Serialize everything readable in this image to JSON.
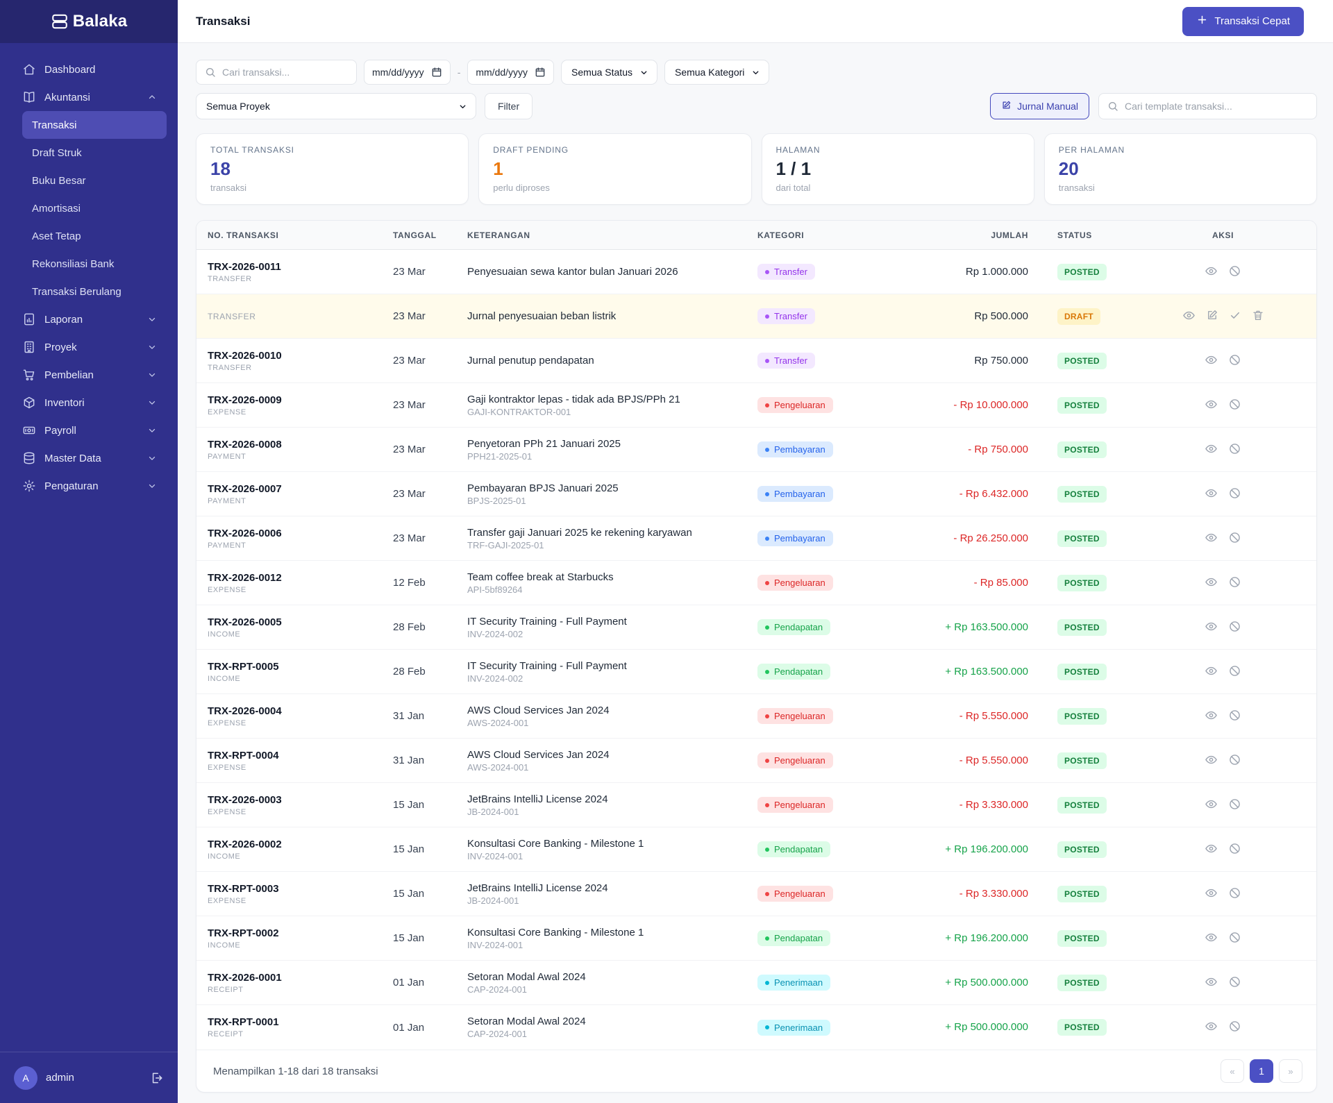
{
  "brand": {
    "name": "Balaka",
    "logo_icon": "ledger-icon"
  },
  "topbar": {
    "title": "Transaksi",
    "quick_action": "Transaksi Cepat",
    "quick_action_icon": "plus-icon"
  },
  "sidebar": {
    "items": [
      {
        "label": "Dashboard",
        "icon": "home-icon"
      },
      {
        "label": "Akuntansi",
        "icon": "book-icon",
        "chevron": "up"
      },
      {
        "label": "Transaksi",
        "child": true,
        "active": true
      },
      {
        "label": "Draft Struk",
        "child": true
      },
      {
        "label": "Buku Besar",
        "child": true
      },
      {
        "label": "Amortisasi",
        "child": true
      },
      {
        "label": "Aset Tetap",
        "child": true
      },
      {
        "label": "Rekonsiliasi Bank",
        "child": true
      },
      {
        "label": "Transaksi Berulang",
        "child": true
      },
      {
        "label": "Laporan",
        "icon": "report-icon",
        "chevron": "down"
      },
      {
        "label": "Proyek",
        "icon": "building-icon",
        "chevron": "down"
      },
      {
        "label": "Pembelian",
        "icon": "cart-icon",
        "chevron": "down"
      },
      {
        "label": "Inventori",
        "icon": "cube-icon",
        "chevron": "down"
      },
      {
        "label": "Payroll",
        "icon": "banknote-icon",
        "chevron": "down"
      },
      {
        "label": "Master Data",
        "icon": "database-icon",
        "chevron": "down"
      },
      {
        "label": "Pengaturan",
        "icon": "gear-icon",
        "chevron": "down"
      }
    ],
    "user": {
      "initial": "A",
      "name": "admin",
      "logout_icon": "logout-icon"
    }
  },
  "filters": {
    "search_placeholder": "Cari transaksi...",
    "date_from": "mm/dd/yyyy",
    "date_to": "mm/dd/yyyy",
    "date_separator": "-",
    "status_select": "Semua Status",
    "category_select": "Semua Kategori",
    "project_select": "Semua Proyek",
    "filter_button": "Filter",
    "journal_button": "Jurnal Manual",
    "template_search_placeholder": "Cari template transaksi..."
  },
  "cards": [
    {
      "label": "TOTAL TRANSAKSI",
      "value": "18",
      "sub": "transaksi",
      "tone": "indigo"
    },
    {
      "label": "DRAFT PENDING",
      "value": "1",
      "sub": "perlu diproses",
      "tone": "orange"
    },
    {
      "label": "HALAMAN",
      "value": "1 / 1",
      "sub": "dari total",
      "tone": "dark"
    },
    {
      "label": "PER HALAMAN",
      "value": "20",
      "sub": "transaksi",
      "tone": "indigo"
    }
  ],
  "table": {
    "columns": [
      "NO. TRANSAKSI",
      "TANGGAL",
      "KETERANGAN",
      "KATEGORI",
      "JUMLAH",
      "STATUS",
      "AKSI"
    ],
    "rows": [
      {
        "number": "TRX-2026-0011",
        "type": "TRANSFER",
        "date": "23 Mar",
        "description": "Penyesuaian sewa kantor bulan Januari 2026",
        "reference": "",
        "category": "Transfer",
        "category_color": "purple",
        "amount": "Rp 1.000.000",
        "amount_tone": "neutral",
        "status": "POSTED",
        "actions": [
          "view",
          "void"
        ],
        "draft": false
      },
      {
        "number": "",
        "type": "TRANSFER",
        "date": "23 Mar",
        "description": "Jurnal penyesuaian beban listrik",
        "reference": "",
        "category": "Transfer",
        "category_color": "purple",
        "amount": "Rp 500.000",
        "amount_tone": "neutral",
        "status": "DRAFT",
        "actions": [
          "view",
          "edit",
          "approve",
          "delete"
        ],
        "draft": true
      },
      {
        "number": "TRX-2026-0010",
        "type": "TRANSFER",
        "date": "23 Mar",
        "description": "Jurnal penutup pendapatan",
        "reference": "",
        "category": "Transfer",
        "category_color": "purple",
        "amount": "Rp 750.000",
        "amount_tone": "neutral",
        "status": "POSTED",
        "actions": [
          "view",
          "void"
        ],
        "draft": false
      },
      {
        "number": "TRX-2026-0009",
        "type": "EXPENSE",
        "date": "23 Mar",
        "description": "Gaji kontraktor lepas - tidak ada BPJS/PPh 21",
        "reference": "GAJI-KONTRAKTOR-001",
        "category": "Pengeluaran",
        "category_color": "red",
        "amount": "- Rp 10.000.000",
        "amount_tone": "neg",
        "status": "POSTED",
        "actions": [
          "view",
          "void"
        ],
        "draft": false
      },
      {
        "number": "TRX-2026-0008",
        "type": "PAYMENT",
        "date": "23 Mar",
        "description": "Penyetoran PPh 21 Januari 2025",
        "reference": "PPH21-2025-01",
        "category": "Pembayaran",
        "category_color": "blue",
        "amount": "- Rp 750.000",
        "amount_tone": "neg",
        "status": "POSTED",
        "actions": [
          "view",
          "void"
        ],
        "draft": false
      },
      {
        "number": "TRX-2026-0007",
        "type": "PAYMENT",
        "date": "23 Mar",
        "description": "Pembayaran BPJS Januari 2025",
        "reference": "BPJS-2025-01",
        "category": "Pembayaran",
        "category_color": "blue",
        "amount": "- Rp 6.432.000",
        "amount_tone": "neg",
        "status": "POSTED",
        "actions": [
          "view",
          "void"
        ],
        "draft": false
      },
      {
        "number": "TRX-2026-0006",
        "type": "PAYMENT",
        "date": "23 Mar",
        "description": "Transfer gaji Januari 2025 ke rekening karyawan",
        "reference": "TRF-GAJI-2025-01",
        "category": "Pembayaran",
        "category_color": "blue",
        "amount": "- Rp 26.250.000",
        "amount_tone": "neg",
        "status": "POSTED",
        "actions": [
          "view",
          "void"
        ],
        "draft": false
      },
      {
        "number": "TRX-2026-0012",
        "type": "EXPENSE",
        "date": "12 Feb",
        "description": "Team coffee break at Starbucks",
        "reference": "API-5bf89264",
        "category": "Pengeluaran",
        "category_color": "red",
        "amount": "- Rp 85.000",
        "amount_tone": "neg",
        "status": "POSTED",
        "actions": [
          "view",
          "void"
        ],
        "draft": false
      },
      {
        "number": "TRX-2026-0005",
        "type": "INCOME",
        "date": "28 Feb",
        "description": "IT Security Training - Full Payment",
        "reference": "INV-2024-002",
        "category": "Pendapatan",
        "category_color": "green",
        "amount": "+ Rp 163.500.000",
        "amount_tone": "pos",
        "status": "POSTED",
        "actions": [
          "view",
          "void"
        ],
        "draft": false
      },
      {
        "number": "TRX-RPT-0005",
        "type": "INCOME",
        "date": "28 Feb",
        "description": "IT Security Training - Full Payment",
        "reference": "INV-2024-002",
        "category": "Pendapatan",
        "category_color": "green",
        "amount": "+ Rp 163.500.000",
        "amount_tone": "pos",
        "status": "POSTED",
        "actions": [
          "view",
          "void"
        ],
        "draft": false
      },
      {
        "number": "TRX-2026-0004",
        "type": "EXPENSE",
        "date": "31 Jan",
        "description": "AWS Cloud Services Jan 2024",
        "reference": "AWS-2024-001",
        "category": "Pengeluaran",
        "category_color": "red",
        "amount": "- Rp 5.550.000",
        "amount_tone": "neg",
        "status": "POSTED",
        "actions": [
          "view",
          "void"
        ],
        "draft": false
      },
      {
        "number": "TRX-RPT-0004",
        "type": "EXPENSE",
        "date": "31 Jan",
        "description": "AWS Cloud Services Jan 2024",
        "reference": "AWS-2024-001",
        "category": "Pengeluaran",
        "category_color": "red",
        "amount": "- Rp 5.550.000",
        "amount_tone": "neg",
        "status": "POSTED",
        "actions": [
          "view",
          "void"
        ],
        "draft": false
      },
      {
        "number": "TRX-2026-0003",
        "type": "EXPENSE",
        "date": "15 Jan",
        "description": "JetBrains IntelliJ License 2024",
        "reference": "JB-2024-001",
        "category": "Pengeluaran",
        "category_color": "red",
        "amount": "- Rp 3.330.000",
        "amount_tone": "neg",
        "status": "POSTED",
        "actions": [
          "view",
          "void"
        ],
        "draft": false
      },
      {
        "number": "TRX-2026-0002",
        "type": "INCOME",
        "date": "15 Jan",
        "description": "Konsultasi Core Banking - Milestone 1",
        "reference": "INV-2024-001",
        "category": "Pendapatan",
        "category_color": "green",
        "amount": "+ Rp 196.200.000",
        "amount_tone": "pos",
        "status": "POSTED",
        "actions": [
          "view",
          "void"
        ],
        "draft": false
      },
      {
        "number": "TRX-RPT-0003",
        "type": "EXPENSE",
        "date": "15 Jan",
        "description": "JetBrains IntelliJ License 2024",
        "reference": "JB-2024-001",
        "category": "Pengeluaran",
        "category_color": "red",
        "amount": "- Rp 3.330.000",
        "amount_tone": "neg",
        "status": "POSTED",
        "actions": [
          "view",
          "void"
        ],
        "draft": false
      },
      {
        "number": "TRX-RPT-0002",
        "type": "INCOME",
        "date": "15 Jan",
        "description": "Konsultasi Core Banking - Milestone 1",
        "reference": "INV-2024-001",
        "category": "Pendapatan",
        "category_color": "green",
        "amount": "+ Rp 196.200.000",
        "amount_tone": "pos",
        "status": "POSTED",
        "actions": [
          "view",
          "void"
        ],
        "draft": false
      },
      {
        "number": "TRX-2026-0001",
        "type": "RECEIPT",
        "date": "01 Jan",
        "description": "Setoran Modal Awal 2024",
        "reference": "CAP-2024-001",
        "category": "Penerimaan",
        "category_color": "cyan",
        "amount": "+ Rp 500.000.000",
        "amount_tone": "pos",
        "status": "POSTED",
        "actions": [
          "view",
          "void"
        ],
        "draft": false
      },
      {
        "number": "TRX-RPT-0001",
        "type": "RECEIPT",
        "date": "01 Jan",
        "description": "Setoran Modal Awal 2024",
        "reference": "CAP-2024-001",
        "category": "Penerimaan",
        "category_color": "cyan",
        "amount": "+ Rp 500.000.000",
        "amount_tone": "pos",
        "status": "POSTED",
        "actions": [
          "view",
          "void"
        ],
        "draft": false
      }
    ]
  },
  "footer": {
    "showing": "Menampilkan 1-18 dari 18 transaksi",
    "prev": "«",
    "page": "1",
    "next": "»"
  }
}
